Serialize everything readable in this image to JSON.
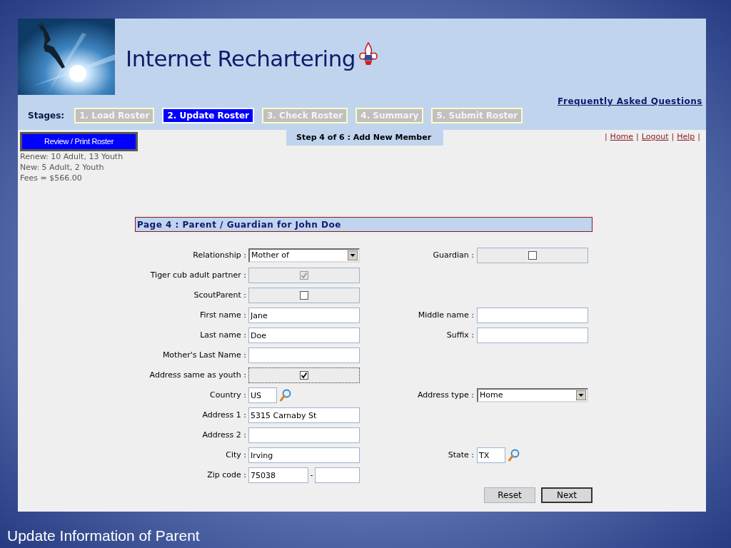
{
  "header": {
    "title": "Internet Rechartering",
    "faq_link": "Frequently Asked Questions",
    "stages_label": "Stages:",
    "stages": [
      {
        "label": "1. Load Roster",
        "selected": false
      },
      {
        "label": "2. Update Roster",
        "selected": true
      },
      {
        "label": "3. Check Roster",
        "selected": false
      },
      {
        "label": "4. Summary",
        "selected": false
      },
      {
        "label": "5. Submit Roster",
        "selected": false
      }
    ]
  },
  "sidebar": {
    "review_button": "Review / Print Roster",
    "summary_lines": [
      "Renew: 10 Adult, 13 Youth",
      "New: 5 Adult, 2 Youth",
      "Fees = $566.00"
    ]
  },
  "step_banner": "Step 4 of 6 : Add New Member",
  "nav_links": {
    "separator": "|",
    "links": [
      "Home",
      "Logout",
      "Help"
    ]
  },
  "form": {
    "title": "Page 4 : Parent / Guardian for John Doe",
    "rows": [
      {
        "left": {
          "label": "Relationship :",
          "kind": "select",
          "value": "Mother of"
        },
        "right": {
          "label": "Guardian :",
          "kind": "checkbox",
          "checked": false,
          "disabled": false,
          "focused": false
        }
      },
      {
        "left": {
          "label": "Tiger cub adult partner :",
          "kind": "checkbox",
          "checked": true,
          "disabled": true,
          "focused": false
        }
      },
      {
        "left": {
          "label": "ScoutParent :",
          "kind": "checkbox",
          "checked": false,
          "disabled": false,
          "focused": false
        }
      },
      {
        "left": {
          "label": "First name :",
          "kind": "text",
          "value": "Jane"
        },
        "right": {
          "label": "Middle name :",
          "kind": "text"
        }
      },
      {
        "left": {
          "label": "Last name :",
          "kind": "text",
          "value": "Doe"
        },
        "right": {
          "label": "Suffix :",
          "kind": "text"
        }
      },
      {
        "left": {
          "label": "Mother's Last Name :",
          "kind": "text"
        }
      },
      {
        "left": {
          "label": "Address same as youth :",
          "kind": "checkbox",
          "checked": true,
          "disabled": false,
          "focused": true
        }
      },
      {
        "left": {
          "label": "Country :",
          "kind": "lookup",
          "value": "US"
        },
        "right": {
          "label": "Address type :",
          "kind": "select",
          "value": "Home"
        }
      },
      {
        "left": {
          "label": "Address 1 :",
          "kind": "text",
          "value": "5315 Carnaby St"
        }
      },
      {
        "left": {
          "label": "Address 2 :",
          "kind": "text"
        }
      },
      {
        "left": {
          "label": "City :",
          "kind": "text",
          "value": "Irving"
        },
        "right": {
          "label": "State :",
          "kind": "lookup",
          "value": "TX"
        }
      },
      {
        "left": {
          "label": "Zip code :",
          "kind": "zip",
          "value": "75038",
          "dash": "-"
        }
      }
    ],
    "buttons": [
      {
        "label": "Reset",
        "default": false
      },
      {
        "label": "Next",
        "default": true
      }
    ]
  },
  "caption": "Update Information of Parent"
}
